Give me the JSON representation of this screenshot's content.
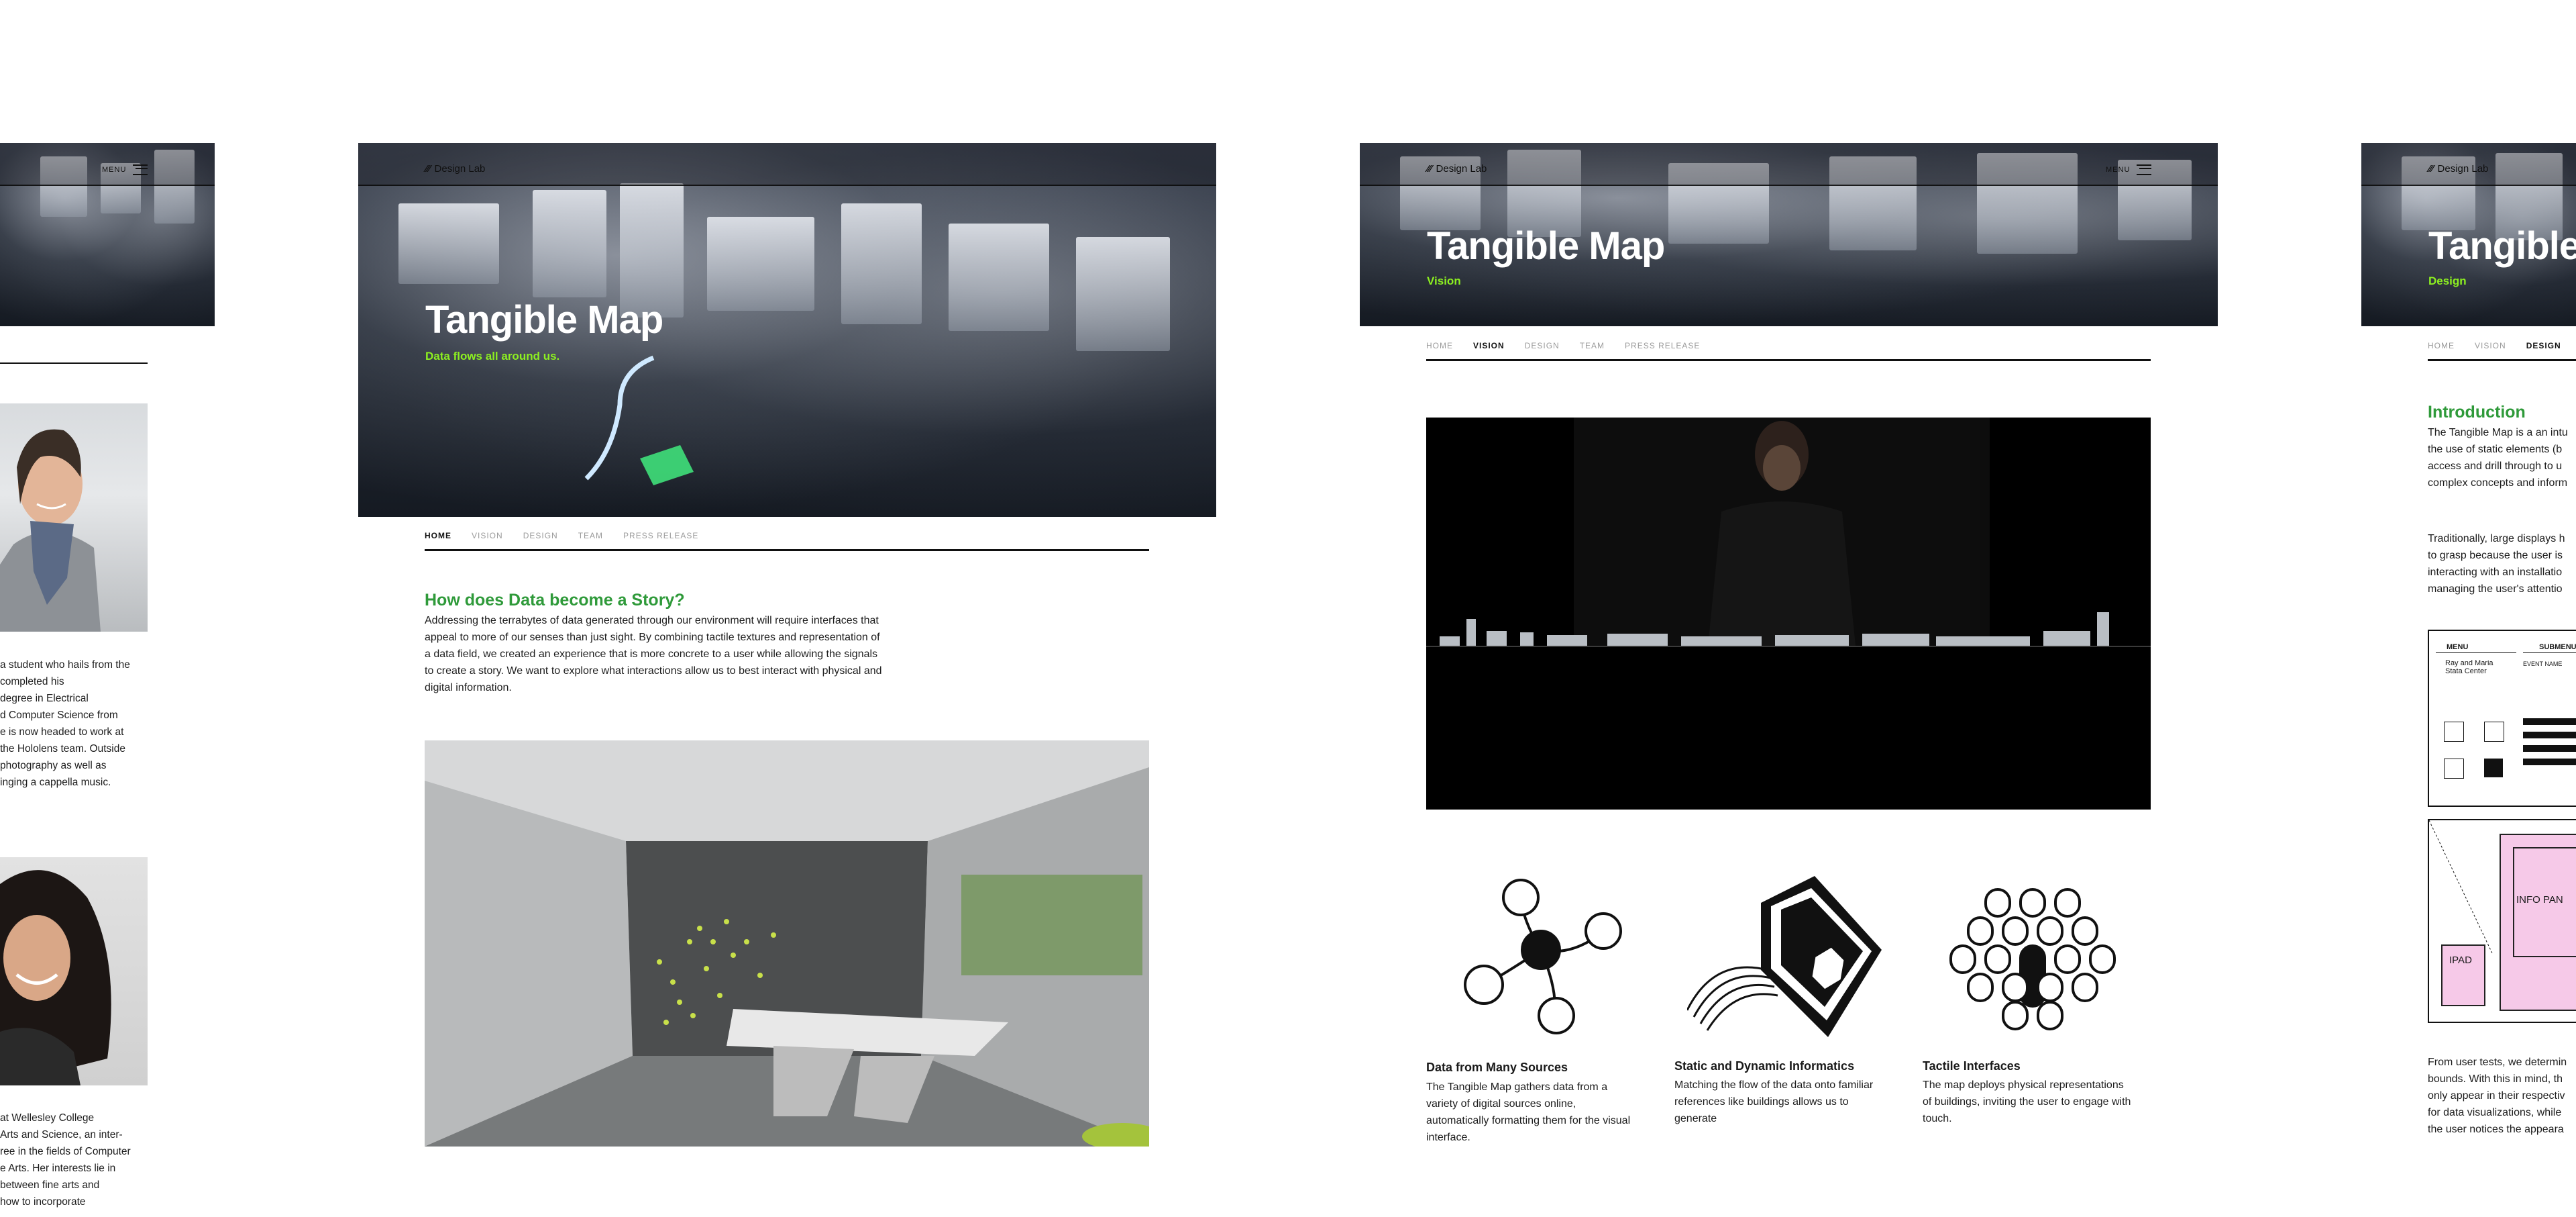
{
  "site": {
    "logo_text": "Design Lab",
    "menu_label": "MENU"
  },
  "nav_tabs": [
    "HOME",
    "VISION",
    "DESIGN",
    "TEAM",
    "PRESS RELEASE"
  ],
  "home": {
    "title": "Tangible Map",
    "tagline": "Data flows all around us.",
    "heading": "How does Data become a Story?",
    "paragraph_lines": [
      "Addressing the terrabytes of data generated through our environment will require interfaces that",
      "appeal to more of our senses than just sight. By combining tactile textures and representation of",
      "a data field, we created an experience that is more concrete to a user while allowing the signals",
      "to create a story. We want to explore what interactions allow us to best interact with physical and",
      "digital information."
    ]
  },
  "vision": {
    "title": "Tangible Map",
    "subtitle": "Vision",
    "features": [
      {
        "title": "Data from Many Sources",
        "lines": [
          "The Tangible Map gathers data from a",
          "variety of digital sources online,",
          "automatically formatting them for the visual",
          "interface."
        ]
      },
      {
        "title": "Static and Dynamic Informatics",
        "lines": [
          "Matching the flow of the data onto familiar",
          "references like buildings allows us to",
          "generate"
        ]
      },
      {
        "title": "Tactile Interfaces",
        "lines": [
          "The map deploys physical representations",
          "of buildings, inviting the user to engage with",
          "touch."
        ]
      }
    ]
  },
  "design": {
    "title": "Tangible",
    "subtitle": "Design",
    "heading": "Introduction",
    "para1_lines": [
      "The Tangible Map is a an intu",
      "the use of static elements (b",
      "access and drill through to u",
      "complex concepts and inform"
    ],
    "para2_lines": [
      "Traditionally, large displays h",
      "to grasp because the user is",
      "interacting with an installatio",
      "managing the user's attentio"
    ],
    "para3_lines": [
      "From user tests, we determin",
      "bounds. With this in mind, th",
      "only appear in their respectiv",
      "for data visualizations, while",
      "the user notices the appeara"
    ],
    "wireframe": {
      "menu": "MENU",
      "submenu": "SUBMENU",
      "center_name": "Ray and Maria Stata Center",
      "event_name": "EVENT NAME"
    },
    "diagram": {
      "info_panel": "INFO PAN",
      "ipad": "IPAD"
    }
  },
  "team": {
    "bio1_lines": [
      "a student who hails from the",
      "completed his",
      "degree in Electrical",
      "d Computer Science from",
      "e is now headed to work at",
      "the Hololens team. Outside",
      "photography as well as",
      "inging a cappella music."
    ],
    "bio2_lines": [
      "at Wellesley College",
      "Arts and Science, an inter-",
      "ree in the fields of Computer",
      "e Arts. Her interests lie in",
      "between fine arts and",
      "how to incorporate"
    ]
  },
  "colors": {
    "accent_green": "#2f9a3a",
    "tagline_green": "#8df020",
    "pink_panel": "#f6c9e8"
  },
  "icons": [
    "logo-mark-icon",
    "hamburger-menu-icon",
    "data-sources-icon",
    "static-dynamic-icon",
    "tactile-interfaces-icon"
  ]
}
